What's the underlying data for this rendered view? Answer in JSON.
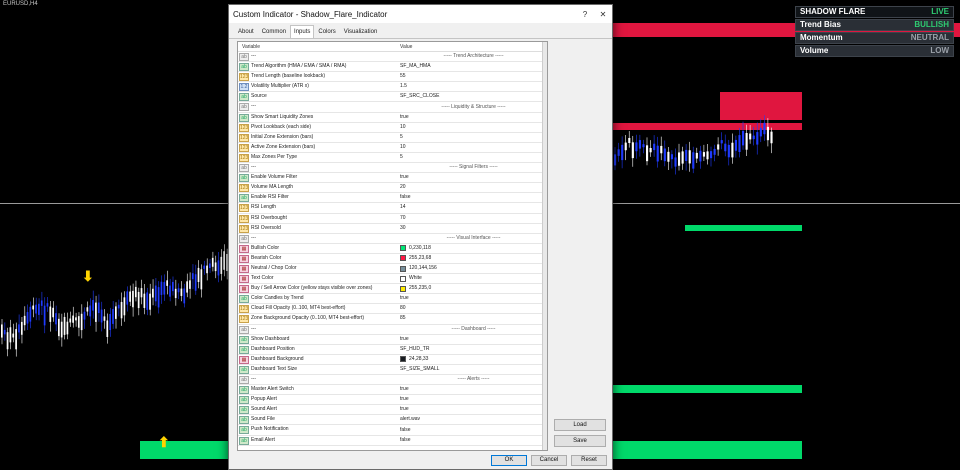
{
  "chart": {
    "symbol": "EURUSD,H4"
  },
  "dashboard": {
    "rows": [
      {
        "label": "SHADOW FLARE",
        "value": "LIVE",
        "color": "#2ecc71"
      },
      {
        "label": "Trend Bias",
        "value": "BULLISH",
        "color": "#2ecc71"
      },
      {
        "label": "Momentum",
        "value": "NEUTRAL",
        "color": "#9aa0a8"
      },
      {
        "label": "Volume",
        "value": "LOW",
        "color": "#9aa0a8"
      }
    ]
  },
  "dialog": {
    "title": "Custom Indicator - Shadow_Flare_Indicator",
    "help_label": "?",
    "close_label": "✕",
    "tabs": [
      "About",
      "Common",
      "Inputs",
      "Colors",
      "Visualization"
    ],
    "active_tab": "Inputs",
    "col_variable": "Variable",
    "col_value": "Value",
    "rows": [
      {
        "type": "sep",
        "name": "---",
        "value": "----- Trend Architecture -----"
      },
      {
        "type": "str",
        "name": "Trend Algorithm (HMA / EMA / SMA / RMA)",
        "value": "SF_MA_HMA"
      },
      {
        "type": "int",
        "name": "Trend Length (baseline lookback)",
        "value": "55"
      },
      {
        "type": "dbl",
        "name": "Volatility Multiplier (ATR x)",
        "value": "1.5"
      },
      {
        "type": "str",
        "name": "Source",
        "value": "SF_SRC_CLOSE"
      },
      {
        "type": "sep",
        "name": "---",
        "value": "----- Liquidity & Structure -----"
      },
      {
        "type": "str",
        "name": "Show Smart Liquidity Zones",
        "value": "true"
      },
      {
        "type": "int",
        "name": "Pivot Lookback (each side)",
        "value": "10"
      },
      {
        "type": "int",
        "name": "Initial Zone Extension (bars)",
        "value": "5"
      },
      {
        "type": "int",
        "name": "Active Zone Extension (bars)",
        "value": "10"
      },
      {
        "type": "int",
        "name": "Max Zones Per Type",
        "value": "5"
      },
      {
        "type": "sep",
        "name": "---",
        "value": "----- Signal Filters -----"
      },
      {
        "type": "str",
        "name": "Enable Volume Filter",
        "value": "true"
      },
      {
        "type": "int",
        "name": "Volume MA Length",
        "value": "20"
      },
      {
        "type": "str",
        "name": "Enable RSI Filter",
        "value": "false"
      },
      {
        "type": "int",
        "name": "RSI Length",
        "value": "14"
      },
      {
        "type": "int",
        "name": "RSI Overbought",
        "value": "70"
      },
      {
        "type": "int",
        "name": "RSI Oversold",
        "value": "30"
      },
      {
        "type": "sep",
        "name": "---",
        "value": "----- Visual Interface -----"
      },
      {
        "type": "col",
        "name": "Bullish Color",
        "value": "0,230,118",
        "swatch": "#00e676"
      },
      {
        "type": "col",
        "name": "Bearish Color",
        "value": "255,23,68",
        "swatch": "#ff1744"
      },
      {
        "type": "col",
        "name": "Neutral / Chop Color",
        "value": "120,144,156",
        "swatch": "#78909c"
      },
      {
        "type": "col",
        "name": "Text Color",
        "value": "White",
        "swatch": "#ffffff"
      },
      {
        "type": "col",
        "name": "Buy / Sell Arrow Color (yellow stays visible over zones)",
        "value": "255,235,0",
        "swatch": "#ffeb00"
      },
      {
        "type": "str",
        "name": "Color Candles by Trend",
        "value": "true"
      },
      {
        "type": "int",
        "name": "Cloud Fill Opacity (0..100, MT4 best-effort)",
        "value": "80"
      },
      {
        "type": "int",
        "name": "Zone Background Opacity (0..100, MT4 best-effort)",
        "value": "85"
      },
      {
        "type": "sep",
        "name": "---",
        "value": "----- Dashboard -----"
      },
      {
        "type": "str",
        "name": "Show Dashboard",
        "value": "true"
      },
      {
        "type": "str",
        "name": "Dashboard Position",
        "value": "SF_HUD_TR"
      },
      {
        "type": "col",
        "name": "Dashboard Background",
        "value": "24,28,33",
        "swatch": "#181c21"
      },
      {
        "type": "str",
        "name": "Dashboard Text Size",
        "value": "SF_SIZE_SMALL"
      },
      {
        "type": "sep",
        "name": "---",
        "value": "----- Alerts -----"
      },
      {
        "type": "str",
        "name": "Master Alert Switch",
        "value": "true"
      },
      {
        "type": "str",
        "name": "Popup Alert",
        "value": "true"
      },
      {
        "type": "str",
        "name": "Sound Alert",
        "value": "true"
      },
      {
        "type": "str",
        "name": "Sound File",
        "value": "alert.wav"
      },
      {
        "type": "str",
        "name": "Push Notification",
        "value": "false"
      },
      {
        "type": "str",
        "name": "Email Alert",
        "value": "false"
      }
    ],
    "load_label": "Load",
    "save_label": "Save",
    "ok_label": "OK",
    "cancel_label": "Cancel",
    "reset_label": "Reset"
  },
  "colors": {
    "bull": "#00d96a",
    "bear": "#e0163f",
    "candle_bull": "#1f3bff",
    "candle_bear": "#ffffff"
  }
}
